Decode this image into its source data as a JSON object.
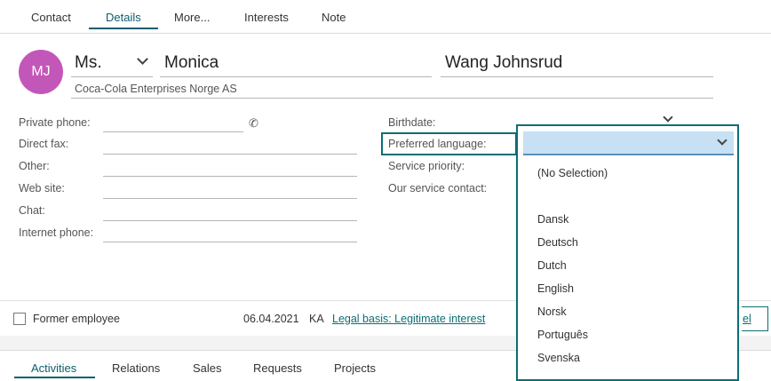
{
  "tabs": [
    {
      "label": "Contact",
      "active": false
    },
    {
      "label": "Details",
      "active": true
    },
    {
      "label": "More...",
      "active": false
    },
    {
      "label": "Interests",
      "active": false
    },
    {
      "label": "Note",
      "active": false
    }
  ],
  "person": {
    "initials": "MJ",
    "salutation": "Ms.",
    "first_name": "Monica",
    "last_name": "Wang Johnsrud",
    "company": "Coca-Cola Enterprises Norge AS"
  },
  "left_fields": {
    "private_phone": "Private phone:",
    "direct_fax": "Direct fax:",
    "other": "Other:",
    "web_site": "Web site:",
    "chat": "Chat:",
    "internet_phone": "Internet phone:"
  },
  "right_fields": {
    "birthdate": "Birthdate:",
    "preferred_language": "Preferred language:",
    "service_priority": "Service priority:",
    "our_service_contact": "Our service contact:"
  },
  "language_dropdown": {
    "selected": "",
    "options": [
      "(No Selection)",
      "Dansk",
      "Deutsch",
      "Dutch",
      "English",
      "Norsk",
      "Português",
      "Svenska"
    ]
  },
  "footer": {
    "former_employee": "Former employee",
    "date": "06.04.2021",
    "initials": "KA",
    "legal_basis": "Legal basis: Legitimate interest",
    "cancel_partial": "el"
  },
  "bottom_tabs": [
    {
      "label": "Activities",
      "active": true
    },
    {
      "label": "Relations",
      "active": false
    },
    {
      "label": "Sales",
      "active": false
    },
    {
      "label": "Requests",
      "active": false
    },
    {
      "label": "Projects",
      "active": false
    }
  ],
  "colors": {
    "accent": "#0b6f74",
    "avatar": "#c357b9",
    "dropdown_selected": "#c7e0f3"
  }
}
